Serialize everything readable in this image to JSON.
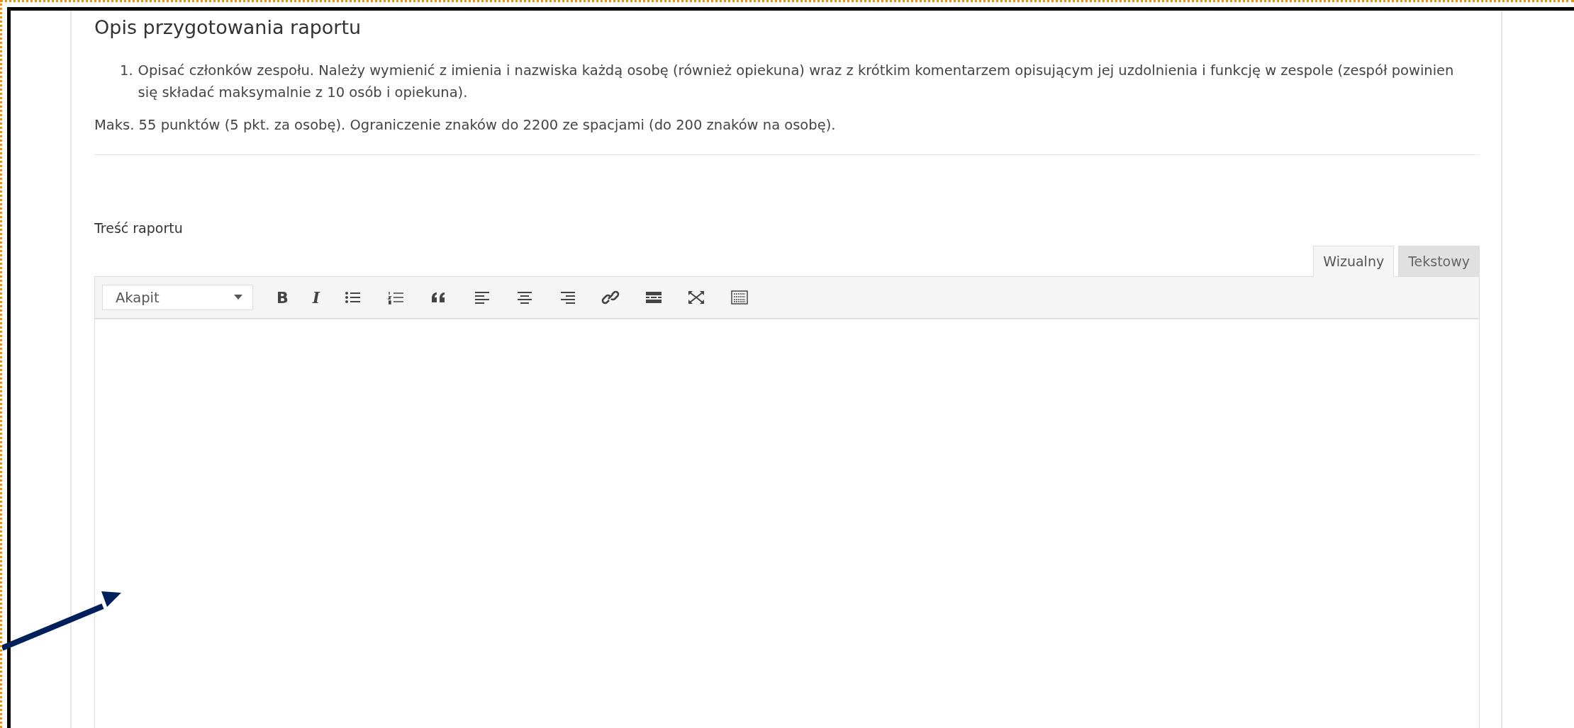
{
  "heading": "Opis przygotowania raportu",
  "instructions": [
    {
      "number": "1.",
      "text": "Opisać członków zespołu. Należy wymienić z imienia i nazwiska każdą osobę (również opiekuna) wraz z krótkim komentarzem opisującym jej uzdolnienia i funkcję w zespole (zespół powinien się składać maksymalnie z 10 osób i opiekuna)."
    }
  ],
  "note": "Maks. 55 punktów (5 pkt. za osobę). Ograniczenie znaków do 2200 ze spacjami (do 200 znaków na osobę).",
  "field_label": "Treść raportu",
  "editor": {
    "tabs": [
      {
        "label": "Wizualny",
        "selected": true
      },
      {
        "label": "Tekstowy",
        "selected": false
      }
    ],
    "format_select": {
      "value": "Akapit"
    },
    "toolbar": [
      {
        "kind": "bold",
        "label": "B"
      },
      {
        "kind": "italic",
        "label": "I"
      },
      {
        "kind": "bullet-list"
      },
      {
        "kind": "numbered-list"
      },
      {
        "kind": "blockquote"
      },
      {
        "kind": "align-left"
      },
      {
        "kind": "align-center"
      },
      {
        "kind": "align-right"
      },
      {
        "kind": "link"
      },
      {
        "kind": "read-more"
      },
      {
        "kind": "fullscreen"
      },
      {
        "kind": "toolbar-toggle"
      }
    ]
  }
}
